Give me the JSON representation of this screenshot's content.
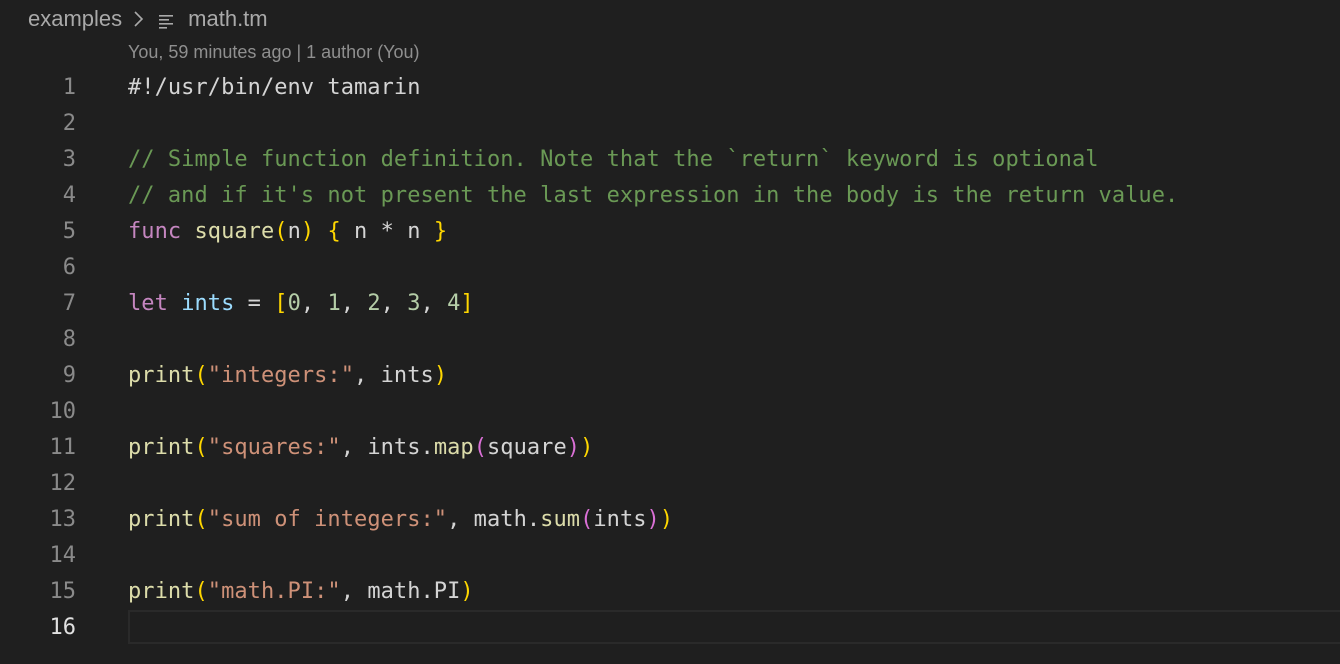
{
  "breadcrumb": {
    "folder": "examples",
    "file": "math.tm"
  },
  "blame": {
    "text": "You, 59 minutes ago | 1 author (You)"
  },
  "editor": {
    "active_line": 16,
    "lines": [
      {
        "number": "1",
        "tokens": [
          {
            "text": "#!/usr/bin/env tamarin",
            "type": "plain"
          }
        ]
      },
      {
        "number": "2",
        "tokens": []
      },
      {
        "number": "3",
        "tokens": [
          {
            "text": "// Simple function definition. Note that the `return` keyword is optional",
            "type": "comment"
          }
        ]
      },
      {
        "number": "4",
        "tokens": [
          {
            "text": "// and if it's not present the last expression in the body is the return value.",
            "type": "comment"
          }
        ]
      },
      {
        "number": "5",
        "tokens": [
          {
            "text": "func",
            "type": "keyword"
          },
          {
            "text": " ",
            "type": "plain"
          },
          {
            "text": "square",
            "type": "func"
          },
          {
            "text": "(",
            "type": "brace1"
          },
          {
            "text": "n",
            "type": "plain"
          },
          {
            "text": ")",
            "type": "brace1"
          },
          {
            "text": " ",
            "type": "plain"
          },
          {
            "text": "{",
            "type": "brace1"
          },
          {
            "text": " n * n ",
            "type": "plain"
          },
          {
            "text": "}",
            "type": "brace1"
          }
        ]
      },
      {
        "number": "6",
        "tokens": []
      },
      {
        "number": "7",
        "tokens": [
          {
            "text": "let",
            "type": "keyword"
          },
          {
            "text": " ",
            "type": "plain"
          },
          {
            "text": "ints",
            "type": "var"
          },
          {
            "text": " = ",
            "type": "plain"
          },
          {
            "text": "[",
            "type": "brace1"
          },
          {
            "text": "0",
            "type": "num"
          },
          {
            "text": ", ",
            "type": "plain"
          },
          {
            "text": "1",
            "type": "num"
          },
          {
            "text": ", ",
            "type": "plain"
          },
          {
            "text": "2",
            "type": "num"
          },
          {
            "text": ", ",
            "type": "plain"
          },
          {
            "text": "3",
            "type": "num"
          },
          {
            "text": ", ",
            "type": "plain"
          },
          {
            "text": "4",
            "type": "num"
          },
          {
            "text": "]",
            "type": "brace1"
          }
        ]
      },
      {
        "number": "8",
        "tokens": []
      },
      {
        "number": "9",
        "tokens": [
          {
            "text": "print",
            "type": "func"
          },
          {
            "text": "(",
            "type": "brace1"
          },
          {
            "text": "\"integers:\"",
            "type": "str"
          },
          {
            "text": ", ints",
            "type": "plain"
          },
          {
            "text": ")",
            "type": "brace1"
          }
        ]
      },
      {
        "number": "10",
        "tokens": []
      },
      {
        "number": "11",
        "tokens": [
          {
            "text": "print",
            "type": "func"
          },
          {
            "text": "(",
            "type": "brace1"
          },
          {
            "text": "\"squares:\"",
            "type": "str"
          },
          {
            "text": ", ints.",
            "type": "plain"
          },
          {
            "text": "map",
            "type": "func"
          },
          {
            "text": "(",
            "type": "brace2"
          },
          {
            "text": "square",
            "type": "plain"
          },
          {
            "text": ")",
            "type": "brace2"
          },
          {
            "text": ")",
            "type": "brace1"
          }
        ]
      },
      {
        "number": "12",
        "tokens": []
      },
      {
        "number": "13",
        "tokens": [
          {
            "text": "print",
            "type": "func"
          },
          {
            "text": "(",
            "type": "brace1"
          },
          {
            "text": "\"sum of integers:\"",
            "type": "str"
          },
          {
            "text": ", math.",
            "type": "plain"
          },
          {
            "text": "sum",
            "type": "func"
          },
          {
            "text": "(",
            "type": "brace2"
          },
          {
            "text": "ints",
            "type": "plain"
          },
          {
            "text": ")",
            "type": "brace2"
          },
          {
            "text": ")",
            "type": "brace1"
          }
        ]
      },
      {
        "number": "14",
        "tokens": []
      },
      {
        "number": "15",
        "tokens": [
          {
            "text": "print",
            "type": "func"
          },
          {
            "text": "(",
            "type": "brace1"
          },
          {
            "text": "\"math.PI:\"",
            "type": "str"
          },
          {
            "text": ", math.PI",
            "type": "plain"
          },
          {
            "text": ")",
            "type": "brace1"
          }
        ]
      },
      {
        "number": "16",
        "tokens": []
      }
    ]
  },
  "colors": {
    "background": "#1f1f1f",
    "comment": "#6a9955",
    "keyword": "#c586c0",
    "function": "#dcdcaa",
    "variable": "#9cdcfe",
    "number": "#b5cea8",
    "string": "#ce9178",
    "bracket_level1": "#ffd700",
    "bracket_level2": "#da70d6"
  }
}
